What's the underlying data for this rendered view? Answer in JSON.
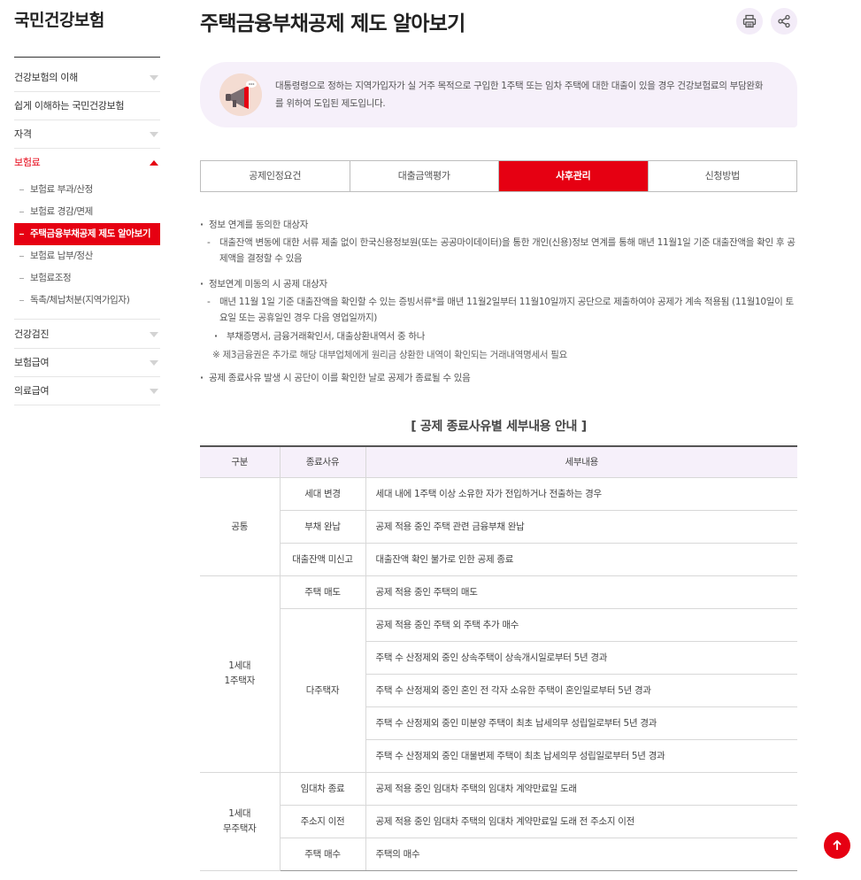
{
  "site": {
    "title": "국민건강보험"
  },
  "sidebar": {
    "items": [
      {
        "label": "건강보험의 이해"
      },
      {
        "label": "쉽게 이해하는 국민건강보험"
      },
      {
        "label": "자격"
      },
      {
        "label": "보험료"
      }
    ],
    "sub_items": [
      {
        "label": "보험료 부과/산정"
      },
      {
        "label": "보험료 경감/면제"
      },
      {
        "label": "주택금융부채공제 제도 알아보기"
      },
      {
        "label": "보험료 납부/정산"
      },
      {
        "label": "보험료조정"
      },
      {
        "label": "독촉/체납처분(지역가입자)"
      }
    ],
    "items_after": [
      {
        "label": "건강검진"
      },
      {
        "label": "보험급여"
      },
      {
        "label": "의료급여"
      }
    ]
  },
  "page": {
    "title": "주택금융부채공제 제도 알아보기"
  },
  "actions": {
    "print_icon": "print-icon",
    "share_icon": "share-icon"
  },
  "intro": {
    "icon": "megaphone-icon",
    "text": "대통령령으로 정하는 지역가입자가 실 거주 목적으로 구입한 1주택 또는 임차 주택에 대한 대출이 있을 경우 건강보험료의 부담완화를 위하여 도입된 제도입니다."
  },
  "tabs": [
    {
      "label": "공제인정요건"
    },
    {
      "label": "대출금액평가"
    },
    {
      "label": "사후관리"
    },
    {
      "label": "신청방법"
    }
  ],
  "info": {
    "b1": "정보 연계를 동의한 대상자",
    "b1_d1": "대출잔액 변동에 대한 서류 제출 없이 한국신용정보원(또는 공공마이데이터)을 통한 개인(신용)정보 연계를 통해 매년 11월1일 기준 대출잔액을 확인 후 공제액을 결정할 수 있음",
    "b2": "정보연계 미동의 시 공제 대상자",
    "b2_d1": "매년 11월 1일 기준 대출잔액을 확인할 수 있는 증빙서류*를 매년 11월2일부터 11월10일까지 공단으로 제출하여야 공제가 계속 적용됨 (11월10일이 토요일 또는 공휴일인 경우 다음 영업일까지)",
    "b2_d2": "부채증명서, 금융거래확인서, 대출상환내역서 중 하나",
    "b2_note": "※ 제3금융권은 추가로 해당 대부업체에게 원리금 상환한 내역이 확인되는 거래내역명세서 필요",
    "b3": "공제 종료사유 발생 시 공단이 이를 확인한 날로 공제가 종료될 수 있음"
  },
  "table": {
    "title": "[ 공제 종료사유별 세부내용 안내 ]",
    "headers": [
      "구분",
      "종료사유",
      "세부내용"
    ],
    "groups": {
      "common": "공통",
      "one_house_l1": "1세대",
      "one_house_l2": "1주택자",
      "no_house_l1": "1세대",
      "no_house_l2": "무주택자"
    },
    "reasons": {
      "r1": "세대 변경",
      "r2": "부채 완납",
      "r3": "대출잔액 미신고",
      "r4": "주택 매도",
      "r5": "다주택자",
      "r6": "임대차 종료",
      "r7": "주소지 이전",
      "r8": "주택 매수"
    },
    "details": [
      "세대 내에 1주택 이상 소유한 자가 전입하거나 전출하는 경우",
      "공제 적용 중인 주택 관련 금융부채 완납",
      "대출잔액 확인 불가로 인한 공제 종료",
      "공제 적용 중인 주택의 매도",
      "공제 적용 중인 주택 외 주택 추가 매수",
      "주택 수 산정제외 중인 상속주택이 상속개시일로부터 5년 경과",
      "주택 수 산정제외 중인 혼인 전 각자 소유한 주택이 혼인일로부터 5년 경과",
      "주택 수 산정제외 중인 미분양 주택이 최초 납세의무 성립일로부터 5년 경과",
      "주택 수 산정제외 중인 대물변제 주택이 최초 납세의무 성립일로부터 5년 경과",
      "공제 적용 중인 임대차 주택의 임대차 계약만료일 도래",
      "공제 적용 중인 임대차 주택의 임대차 계약만료일 도래 전 주소지 이전",
      "주택의 매수"
    ]
  },
  "top_button": {
    "icon": "arrow-up-icon"
  },
  "colors": {
    "accent": "#e60012",
    "lavender": "#f6f0fa"
  }
}
